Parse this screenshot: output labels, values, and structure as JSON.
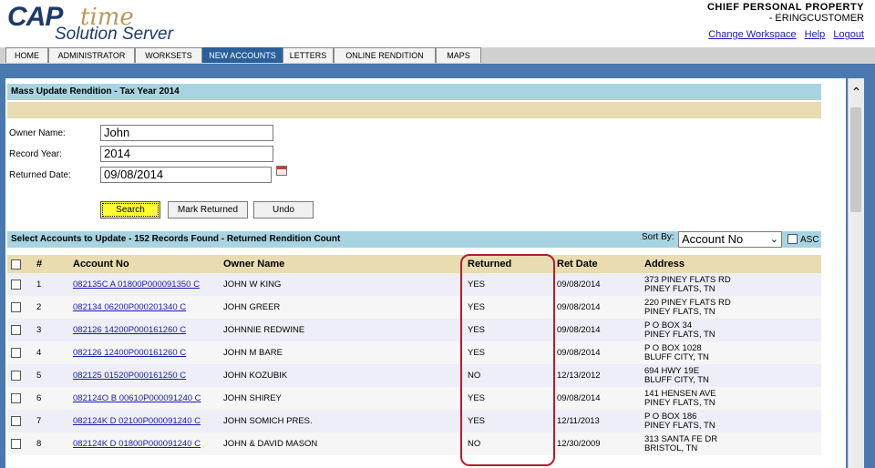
{
  "header": {
    "logo_cap": "CAP",
    "logo_time": "time",
    "logo_sub": "Solution Server",
    "user_line1": "CHIEF   PERSONAL PROPERTY",
    "user_line2": "- ERINGCUSTOMER",
    "links": [
      "Change Workspace",
      "Help",
      "Logout"
    ]
  },
  "tabs": [
    {
      "label": "HOME",
      "active": false
    },
    {
      "label": "ADMINISTRATOR",
      "active": false
    },
    {
      "label": "WORKSETS",
      "active": false
    },
    {
      "label": "NEW ACCOUNTS",
      "active": true
    },
    {
      "label": "LETTERS",
      "active": false
    },
    {
      "label": "ONLINE RENDITION",
      "active": false
    },
    {
      "label": "MAPS",
      "active": false
    }
  ],
  "form": {
    "title": "Mass Update Rendition - Tax Year 2014",
    "owner_label": "Owner Name:",
    "owner_value": "John",
    "year_label": "Record Year:",
    "year_value": "2014",
    "returned_label": "Returned Date:",
    "returned_value": "09/08/2014",
    "search_btn": "Search",
    "mark_btn": "Mark Returned",
    "undo_btn": "Undo"
  },
  "results": {
    "title": "Select Accounts to Update - 152 Records Found - Returned Rendition Count",
    "sort_label": "Sort By:",
    "sort_value": "Account No",
    "asc_label": "ASC",
    "columns": [
      "#",
      "Account No",
      "Owner Name",
      "Returned",
      "Ret Date",
      "Address"
    ],
    "rows": [
      {
        "n": "1",
        "account": "082135C A 01800P000091350 C",
        "owner": "JOHN W KING",
        "returned": "YES",
        "date": "09/08/2014",
        "addr1": "373 PINEY FLATS RD",
        "addr2": "PINEY FLATS, TN"
      },
      {
        "n": "2",
        "account": "082134 06200P000201340 C",
        "owner": "JOHN GREER",
        "returned": "YES",
        "date": "09/08/2014",
        "addr1": "220 PINEY FLATS RD",
        "addr2": "PINEY FLATS, TN"
      },
      {
        "n": "3",
        "account": "082126 14200P000161260 C",
        "owner": "JOHNNIE REDWINE",
        "returned": "YES",
        "date": "09/08/2014",
        "addr1": "P O BOX 34",
        "addr2": "PINEY FLATS, TN"
      },
      {
        "n": "4",
        "account": "082126 12400P000161260 C",
        "owner": "JOHN M BARE",
        "returned": "YES",
        "date": "09/08/2014",
        "addr1": "P O BOX 1028",
        "addr2": "BLUFF CITY, TN"
      },
      {
        "n": "5",
        "account": "082125 01520P000161250 C",
        "owner": "JOHN KOZUBIK",
        "returned": "NO",
        "date": "12/13/2012",
        "addr1": "694 HWY 19E",
        "addr2": "BLUFF CITY, TN"
      },
      {
        "n": "6",
        "account": "082124O B 00610P000091240 C",
        "owner": "JOHN SHIREY",
        "returned": "YES",
        "date": "09/08/2014",
        "addr1": "141 HENSEN AVE",
        "addr2": "PINEY FLATS, TN"
      },
      {
        "n": "7",
        "account": "082124K D 02100P000091240 C",
        "owner": "JOHN SOMICH PRES.",
        "returned": "YES",
        "date": "12/11/2013",
        "addr1": "P O BOX 186",
        "addr2": "PINEY FLATS, TN"
      },
      {
        "n": "8",
        "account": "082124K D 01800P000091240 C",
        "owner": "JOHN & DAVID MASON",
        "returned": "NO",
        "date": "12/30/2009",
        "addr1": "313 SANTA FE DR",
        "addr2": "BRISTOL, TN"
      }
    ]
  },
  "icons": {
    "calendar": "calendar-icon",
    "scroll_up": "chevron-up-icon"
  },
  "colors": {
    "accent_blue": "#4a79b0",
    "section_head": "#a8d4e2",
    "tan": "#e8dcb0",
    "link": "#1a1ab0",
    "highlight": "#b01e2e"
  }
}
